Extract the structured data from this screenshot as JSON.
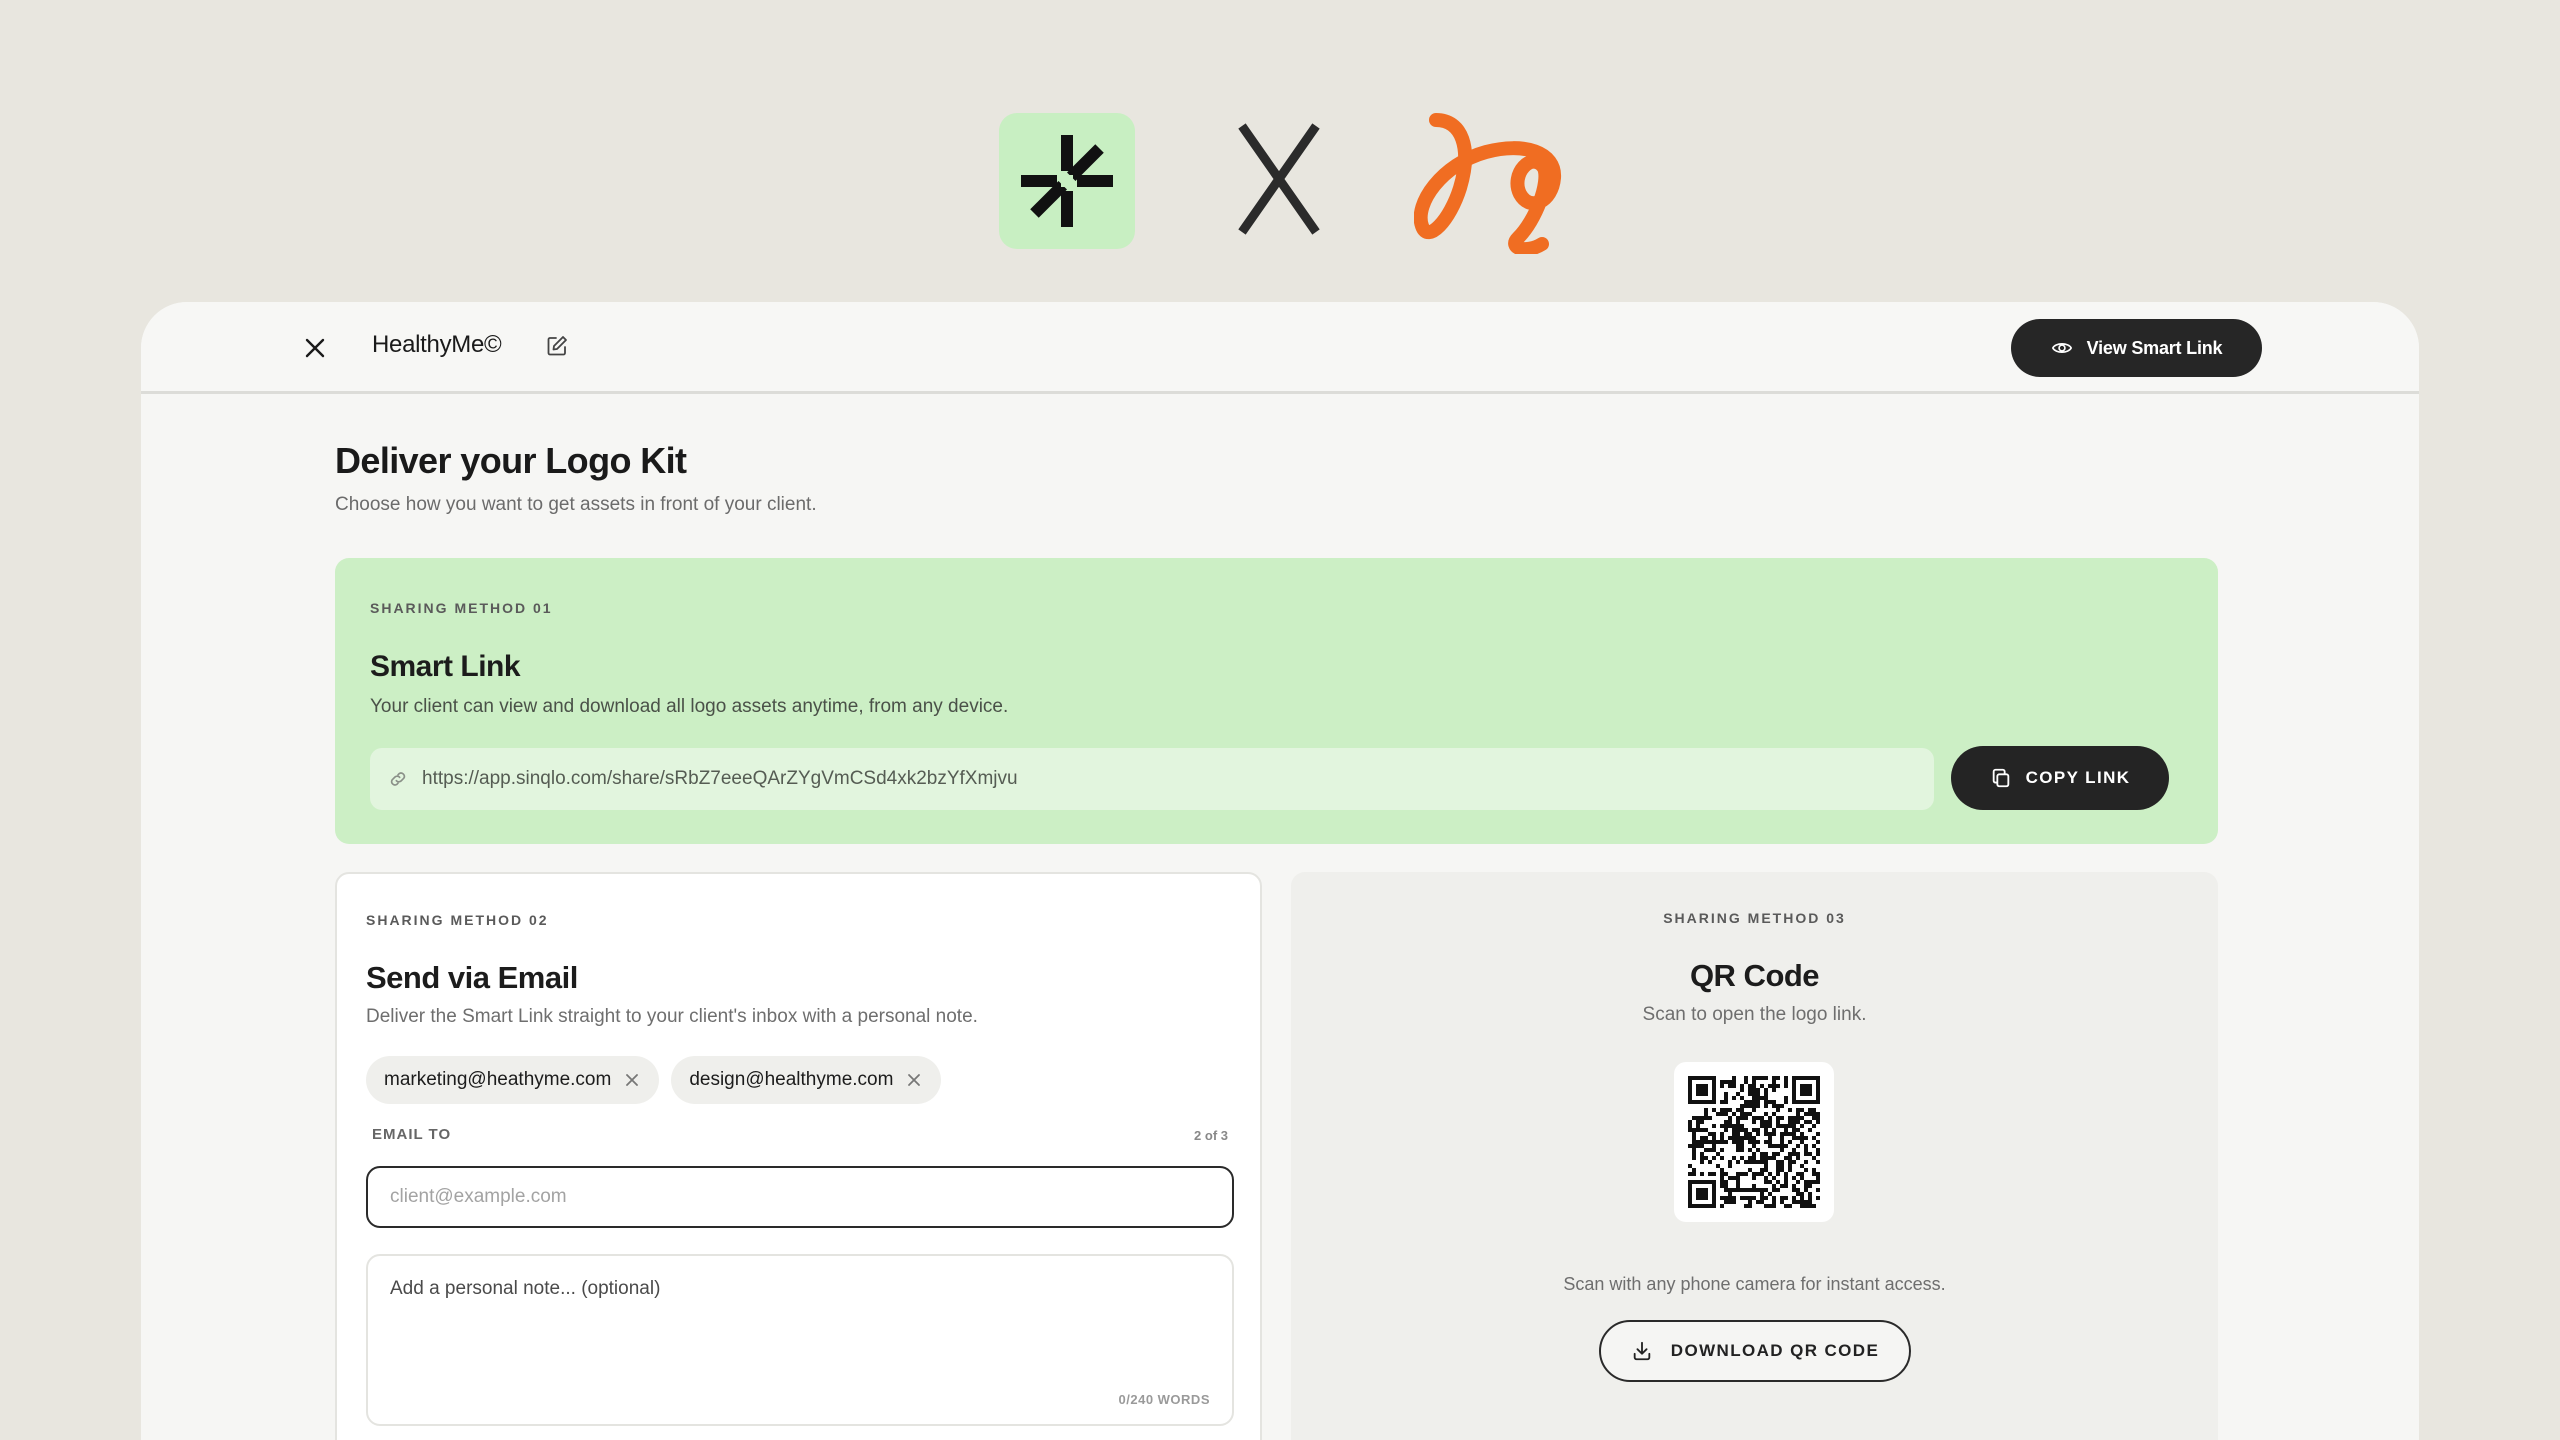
{
  "brand": {
    "left_logo_icon": "asterisk-spark-icon",
    "separator": "X",
    "right_logo_icon": "loop-script-icon",
    "left_tile_color": "#c8efc2",
    "right_logo_color": "#f06d22"
  },
  "header": {
    "project_name": "HealthyMe©",
    "view_button_label": "View Smart Link"
  },
  "page": {
    "title": "Deliver your Logo Kit",
    "subtitle": "Choose how you want to get assets in front of your client."
  },
  "method1": {
    "eyebrow": "SHARING METHOD 01",
    "title": "Smart Link",
    "description": "Your client can view and download all logo assets anytime, from any device.",
    "url": "https://app.sinqlo.com/share/sRbZ7eeeQArZYgVmCSd4xk2bzYfXmjvu",
    "copy_label": "COPY LINK",
    "accent": "#ccefc5"
  },
  "method2": {
    "eyebrow": "SHARING METHOD 02",
    "title": "Send via Email",
    "description": "Deliver the Smart Link straight to your client's inbox with a personal note.",
    "recipients": [
      "marketing@heathyme.com",
      "design@healthyme.com"
    ],
    "email_label": "EMAIL TO",
    "email_count": "2 of 3",
    "email_placeholder": "client@example.com",
    "note_placeholder": "Add a personal note... (optional)",
    "word_count": "0/240 WORDS"
  },
  "method3": {
    "eyebrow": "SHARING METHOD 03",
    "title": "QR Code",
    "description": "Scan to open the logo link.",
    "caption": "Scan with any phone camera for instant access.",
    "download_label": "DOWNLOAD QR CODE"
  }
}
